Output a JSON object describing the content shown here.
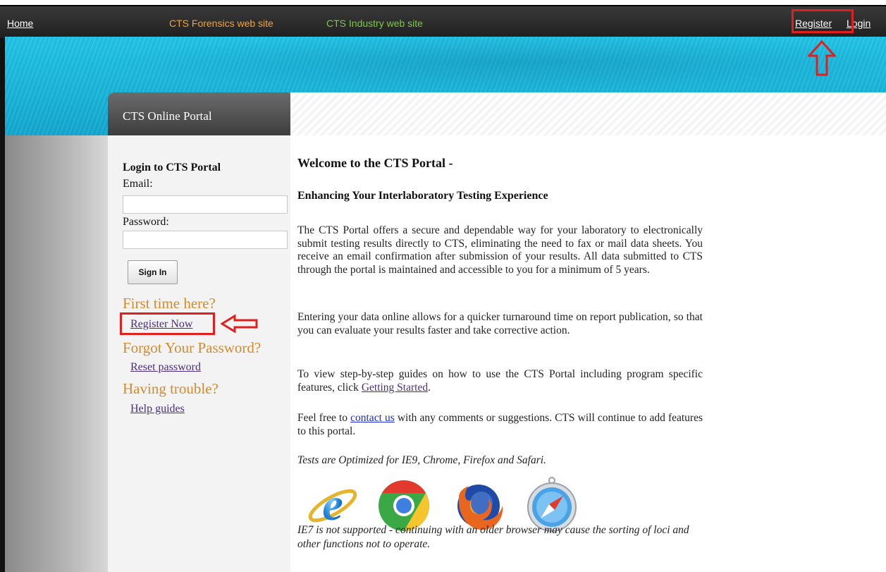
{
  "topbar": {
    "home": "Home",
    "forensics": "CTS Forensics web site",
    "industry": "CTS Industry web site",
    "register": "Register",
    "login": "Login"
  },
  "portal_tab": "CTS Online Portal",
  "sidebar": {
    "login_title": "Login to CTS Portal",
    "email_label": "Email:",
    "email_value": "",
    "password_label": "Password:",
    "password_value": "",
    "sign_in": "Sign In",
    "first_time": "First time here?",
    "register_now": "Register Now",
    "forgot": "Forgot Your Password?",
    "reset_password": "Reset password",
    "trouble": "Having trouble?",
    "help_guides": "Help guides"
  },
  "content": {
    "welcome": "Welcome to the CTS Portal -",
    "subtitle": "Enhancing Your Interlaboratory Testing Experience",
    "para1": "The CTS Portal offers a secure and dependable way for your laboratory to electronically submit testing results directly to CTS, eliminating the need to fax or mail data sheets. You receive an email confirmation after submission of your results. All data submitted to CTS through the portal is maintained and accessible to you for a minimum of 5 years.",
    "para2": "Entering your data online allows for a quicker turnaround time on report publication, so that you can evaluate your results faster and take corrective action.",
    "para3_before": "To view step-by-step guides on how to use the CTS Portal including program specific features, click ",
    "para3_link": "Getting Started",
    "para3_after": ".",
    "para4_before": "Feel free to ",
    "para4_link": "contact us",
    "para4_after": " with any comments or suggestions. CTS will continue to add features to this portal.",
    "tests_note": "Tests are Optimized for IE9, Chrome, Firefox and Safari.",
    "browsers": [
      "ie-icon",
      "chrome-icon",
      "firefox-icon",
      "safari-icon"
    ],
    "ie7_note": "IE7 is not supported - continuing with an older browser may cause the sorting of loci and other functions not to operate."
  },
  "colors": {
    "annotation_red": "#e0201f",
    "banner_cyan": "#1ab4da",
    "heading_orange": "#d48a2e",
    "link_purple": "#4a2d82"
  }
}
